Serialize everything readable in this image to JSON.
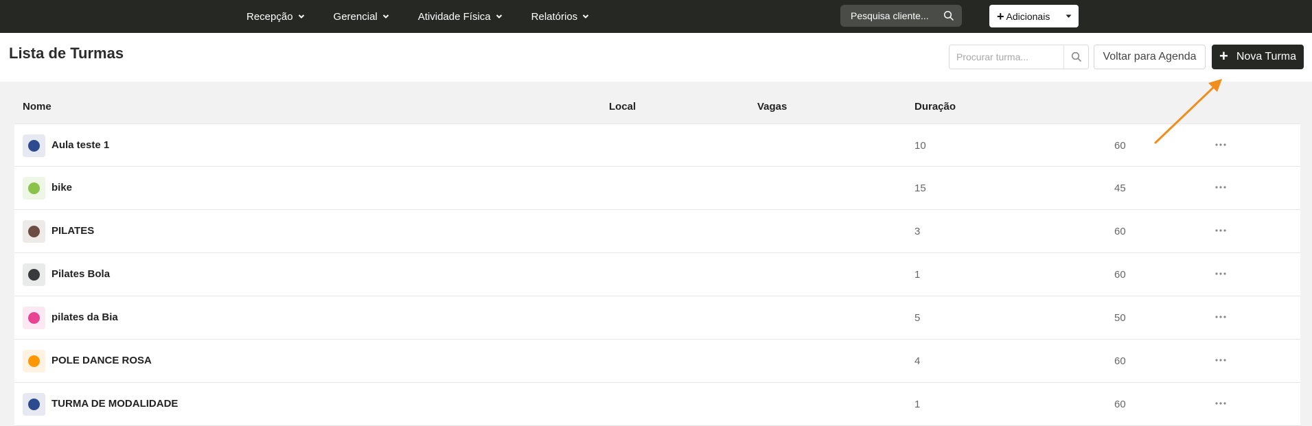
{
  "nav": {
    "menu": [
      {
        "label": "Recepção"
      },
      {
        "label": "Gerencial"
      },
      {
        "label": "Atividade Física"
      },
      {
        "label": "Relatórios"
      }
    ],
    "search_label": "Pesquisa cliente...",
    "add_label": "Adicionais"
  },
  "header": {
    "title": "Lista de Turmas",
    "search_placeholder": "Procurar turma...",
    "back_label": "Voltar para Agenda",
    "new_label": "Nova Turma"
  },
  "table": {
    "columns": [
      "Nome",
      "Local",
      "Vagas",
      "Duração"
    ],
    "rows": [
      {
        "name": "Aula teste 1",
        "color": "#2c4b8e",
        "tint": "#e6e9f1",
        "vagas": "10",
        "duracao": "60"
      },
      {
        "name": "bike",
        "color": "#8bc34a",
        "tint": "#eef6e6",
        "vagas": "15",
        "duracao": "45"
      },
      {
        "name": "PILATES",
        "color": "#6d4c41",
        "tint": "#eeeae8",
        "vagas": "3",
        "duracao": "60"
      },
      {
        "name": "Pilates Bola",
        "color": "#37393b",
        "tint": "#e9eaea",
        "vagas": "1",
        "duracao": "60"
      },
      {
        "name": "pilates da Bia",
        "color": "#e84393",
        "tint": "#fce8f2",
        "vagas": "5",
        "duracao": "50"
      },
      {
        "name": "POLE DANCE ROSA",
        "color": "#ff9800",
        "tint": "#fff2e0",
        "vagas": "4",
        "duracao": "60"
      },
      {
        "name": "TURMA DE MODALIDADE",
        "color": "#2c4b8e",
        "tint": "#e6e9f1",
        "vagas": "1",
        "duracao": "60"
      }
    ]
  },
  "colors": {
    "nav_bg": "#262824",
    "accent_arrow": "#f28c1b"
  }
}
